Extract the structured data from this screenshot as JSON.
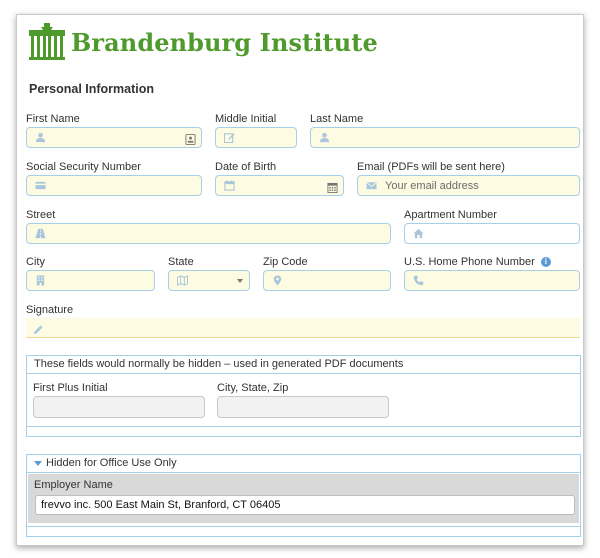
{
  "brand": {
    "name": "Brandenburg Institute",
    "color": "#4f9a2c"
  },
  "section_title": "Personal Information",
  "fields": {
    "first_name": {
      "label": "First Name",
      "icon": "user-icon",
      "value": ""
    },
    "middle_initial": {
      "label": "Middle Initial",
      "icon": "edit-icon",
      "value": ""
    },
    "last_name": {
      "label": "Last Name",
      "icon": "user-icon",
      "value": ""
    },
    "ssn": {
      "label": "Social Security Number",
      "icon": "card-icon",
      "value": ""
    },
    "dob": {
      "label": "Date of Birth",
      "icon": "calendar-icon",
      "value": ""
    },
    "email": {
      "label": "Email (PDFs will be sent here)",
      "icon": "envelope-icon",
      "placeholder": "Your email address"
    },
    "street": {
      "label": "Street",
      "icon": "road-icon",
      "value": ""
    },
    "apartment": {
      "label": "Apartment Number",
      "icon": "home-icon",
      "value": ""
    },
    "city": {
      "label": "City",
      "icon": "building-icon",
      "value": ""
    },
    "state": {
      "label": "State",
      "icon": "map-icon",
      "value": ""
    },
    "zip": {
      "label": "Zip Code",
      "icon": "map-marker-icon",
      "value": ""
    },
    "home_phone": {
      "label": "U.S. Home Phone Number",
      "icon": "phone-icon",
      "value": ""
    },
    "signature": {
      "label": "Signature",
      "icon": "pencil-icon"
    }
  },
  "hidden_panel": {
    "heading": "These fields would normally be hidden – used in generated PDF documents",
    "first_plus_initial": {
      "label": "First Plus Initial",
      "value": ""
    },
    "city_state_zip": {
      "label": "City, State, Zip",
      "value": ""
    }
  },
  "office_panel": {
    "heading": "Hidden for Office Use Only",
    "employer_name": {
      "label": "Employer Name",
      "value": "frevvo inc. 500 East Main St, Branford, CT 06405"
    }
  },
  "colors": {
    "field_fill": "#fdfbe1",
    "field_border": "#a8cfe8",
    "icon": "#a9c6dc",
    "accent": "#5b9bd5"
  }
}
